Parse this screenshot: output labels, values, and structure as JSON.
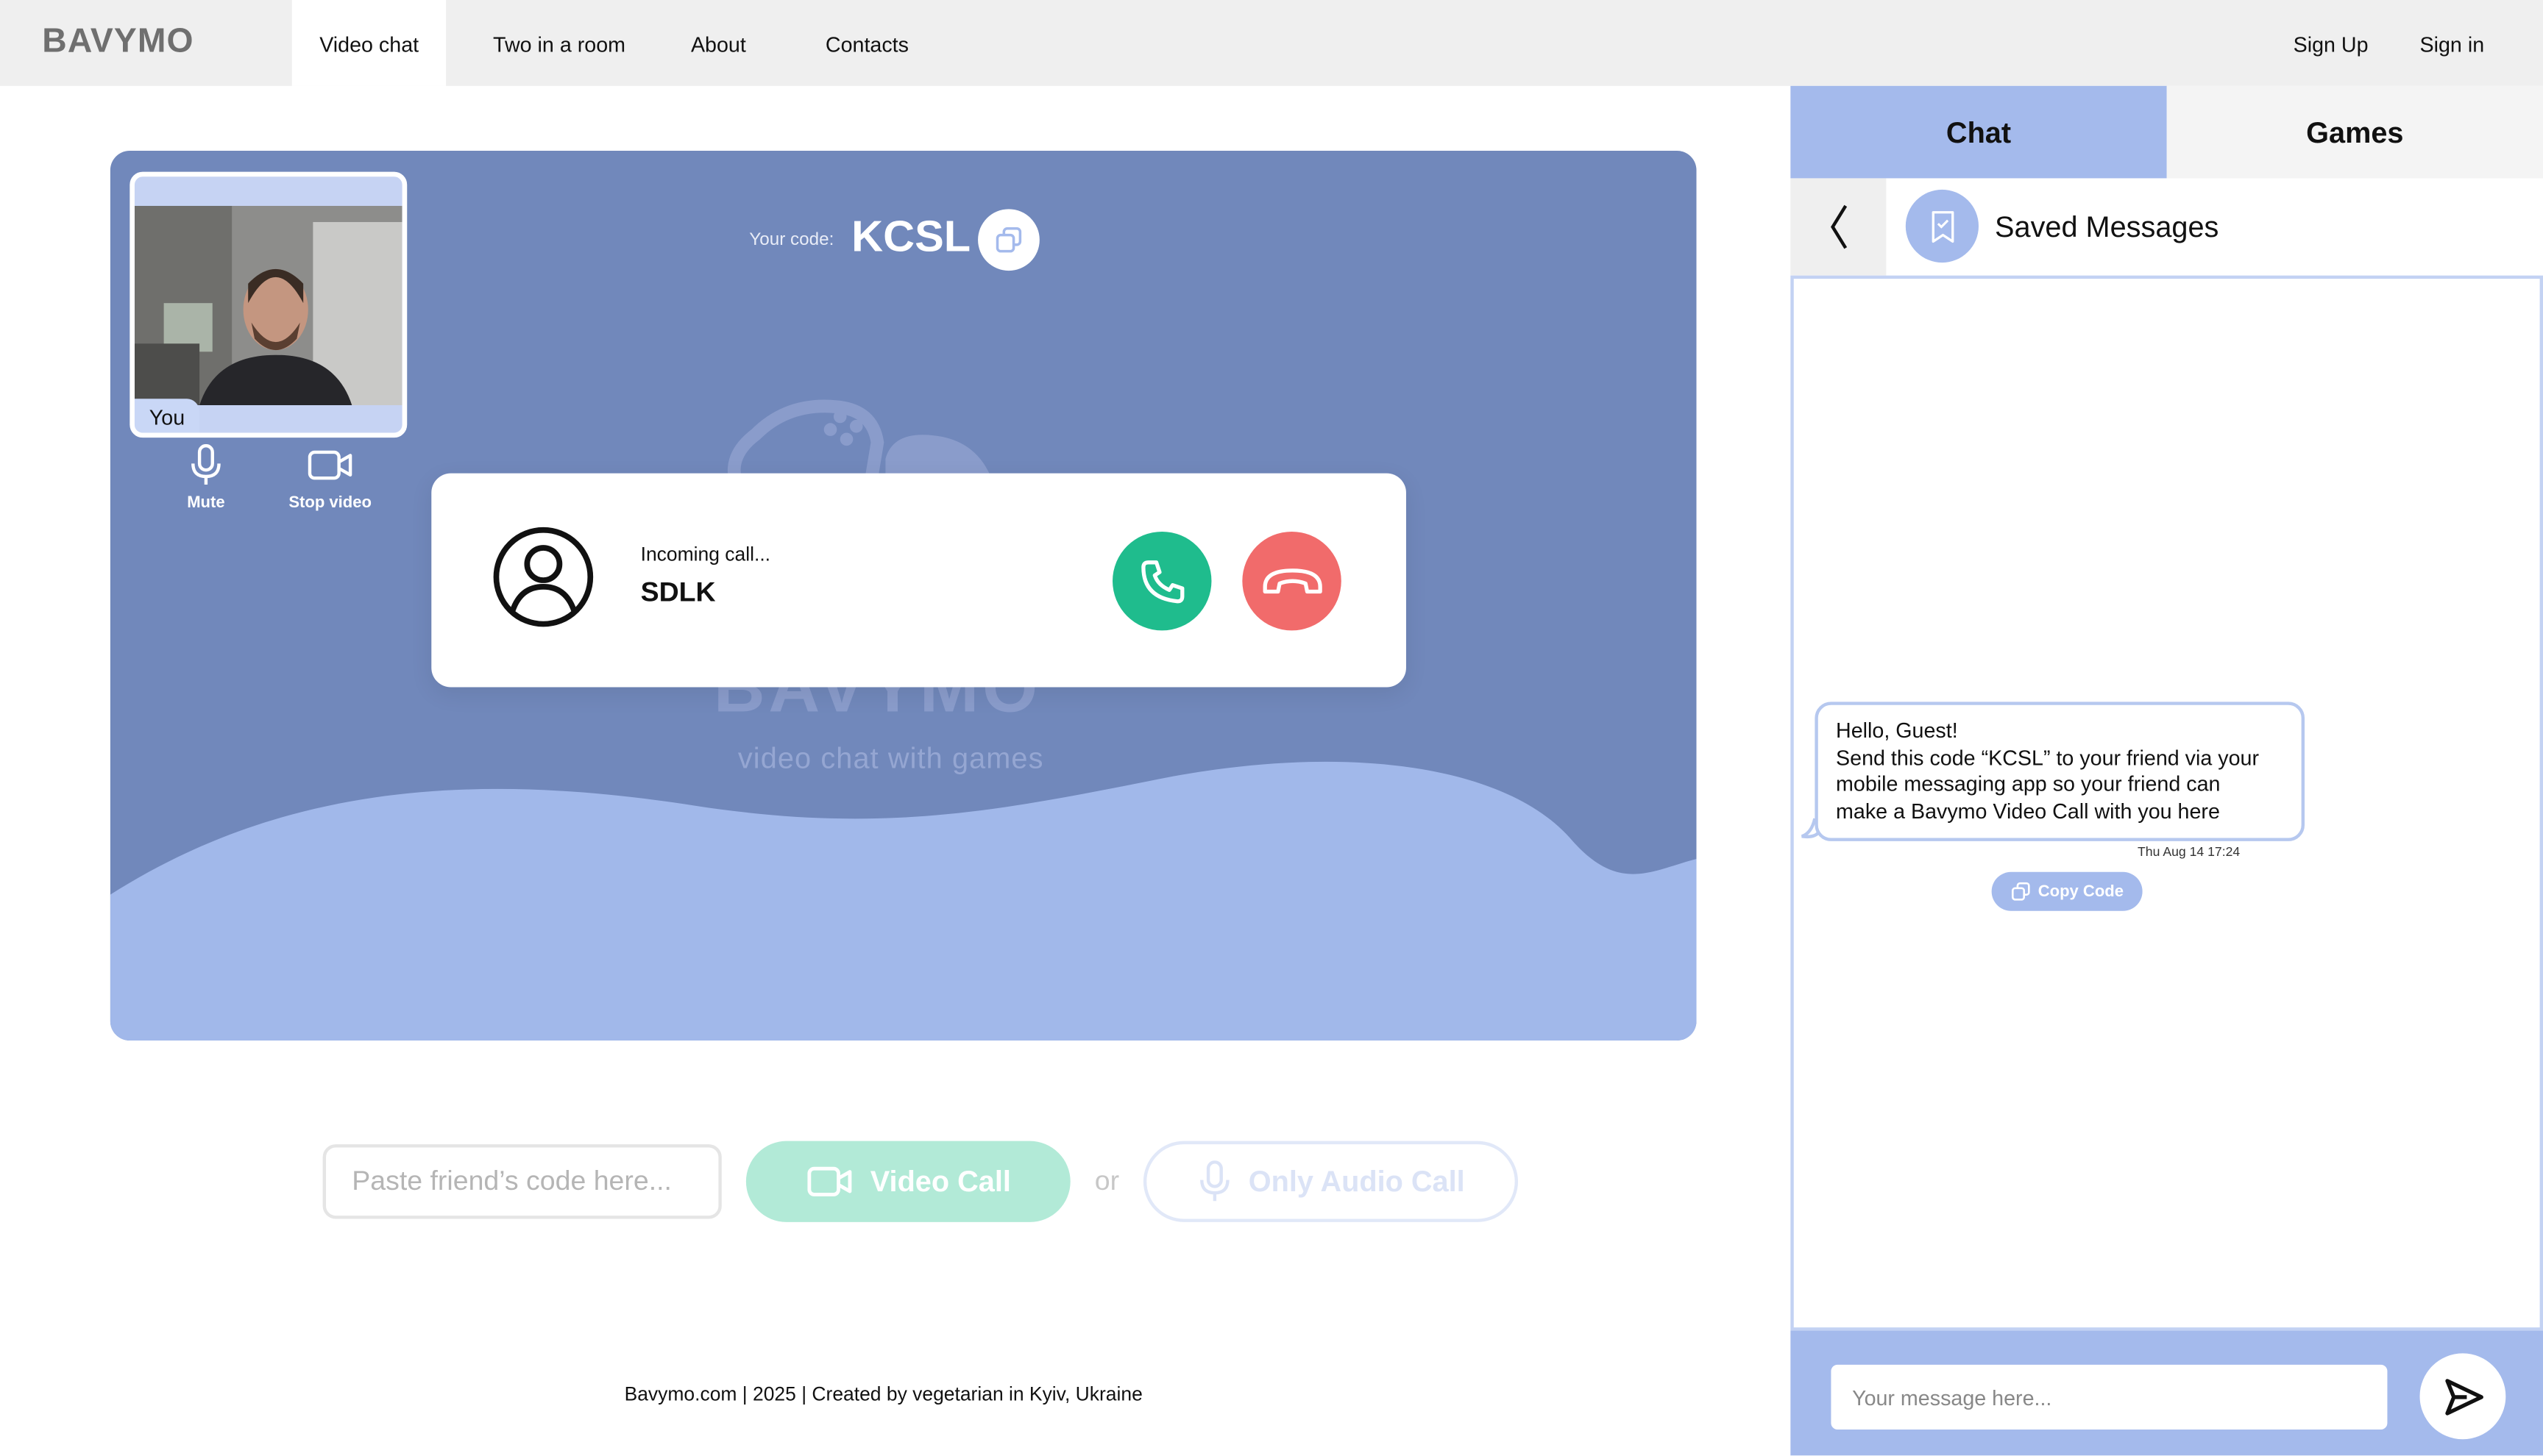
{
  "header": {
    "logo": "BAVYMO",
    "nav": {
      "video_chat": "Video chat",
      "two_in_room": "Two in a room",
      "about": "About",
      "contacts": "Contacts"
    },
    "sign_up": "Sign Up",
    "sign_in": "Sign in"
  },
  "stage": {
    "code_label": "Your code:",
    "code_value": "KCSL",
    "watermark_title": "BAVYMO",
    "watermark_subtitle": "video chat with games",
    "self_label": "You",
    "mute_label": "Mute",
    "stop_video_label": "Stop video"
  },
  "incoming_call": {
    "status": "Incoming call...",
    "caller_code": "SDLK"
  },
  "call_bar": {
    "code_placeholder": "Paste friend’s code here...",
    "video_call": "Video Call",
    "or": "or",
    "audio_call": "Only Audio Call"
  },
  "footer": "Bavymo.com | 2025 | Created by vegetarian in Kyiv, Ukraine",
  "panel": {
    "tabs": {
      "chat": "Chat",
      "games": "Games"
    },
    "conversation_title": "Saved Messages",
    "message": {
      "line1": "Hello, Guest!",
      "line2": "Send this code “KCSL” to your friend via your",
      "line3": "mobile messaging app so your friend can",
      "line4": "make a Bavymo Video Call with you here",
      "time": "Thu Aug 14  17:24"
    },
    "copy_code": "Copy Code",
    "input_placeholder": "Your message here..."
  },
  "colors": {
    "stage_bg": "#7188bb",
    "wave": "#a1b8ea",
    "accept": "#1fbc8d",
    "decline": "#f16b6b",
    "panel_accent": "#a4baec"
  }
}
